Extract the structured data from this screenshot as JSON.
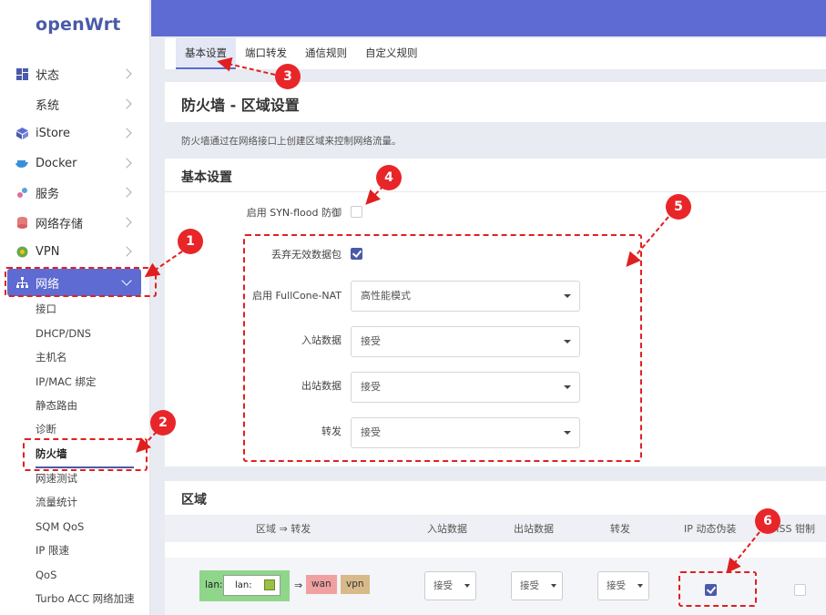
{
  "brand": {
    "logo": "openWrt",
    "accent": "#5d6bd2"
  },
  "sidebar": {
    "items": [
      {
        "label": "状态",
        "icon": "dashboard-icon"
      },
      {
        "label": "系统",
        "icon": "gear-icon"
      },
      {
        "label": "iStore",
        "icon": "store-cube-icon"
      },
      {
        "label": "Docker",
        "icon": "docker-whale-icon"
      },
      {
        "label": "服务",
        "icon": "services-icon"
      },
      {
        "label": "网络存储",
        "icon": "storage-icon"
      },
      {
        "label": "VPN",
        "icon": "vpn-icon"
      },
      {
        "label": "网络",
        "icon": "network-icon"
      }
    ],
    "network_sub": [
      "接口",
      "DHCP/DNS",
      "主机名",
      "IP/MAC 绑定",
      "静态路由",
      "诊断",
      "防火墙",
      "网速测试",
      "流量统计",
      "SQM QoS",
      "IP 限速",
      "QoS",
      "Turbo ACC 网络加速"
    ]
  },
  "tabs": [
    "基本设置",
    "端口转发",
    "通信规则",
    "自定义规则"
  ],
  "page": {
    "title": "防火墙 - 区域设置",
    "description": "防火墙通过在网络接口上创建区域来控制网络流量。"
  },
  "basic": {
    "heading": "基本设置",
    "syn_flood_label": "启用 SYN-flood 防御",
    "drop_invalid_label": "丢弃无效数据包",
    "fullcone_label": "启用 FullCone-NAT",
    "fullcone_value": "高性能模式",
    "input_label": "入站数据",
    "input_value": "接受",
    "output_label": "出站数据",
    "output_value": "接受",
    "forward_label": "转发",
    "forward_value": "接受"
  },
  "zones": {
    "heading": "区域",
    "columns": [
      "区域 ⇒ 转发",
      "入站数据",
      "出站数据",
      "转发",
      "IP 动态伪装",
      "MSS 钳制"
    ],
    "row": {
      "zone_name": "lan:",
      "interface": "lan:",
      "arrow": "⇒",
      "dest1": "wan",
      "dest2": "vpn",
      "input": "接受",
      "output": "接受",
      "forward": "接受"
    },
    "colors": {
      "lan": "#8fd68a",
      "wan": "#f0a0a0",
      "vpn": "#d8b98a"
    }
  },
  "annotations": [
    "1",
    "2",
    "3",
    "4",
    "5",
    "6"
  ]
}
